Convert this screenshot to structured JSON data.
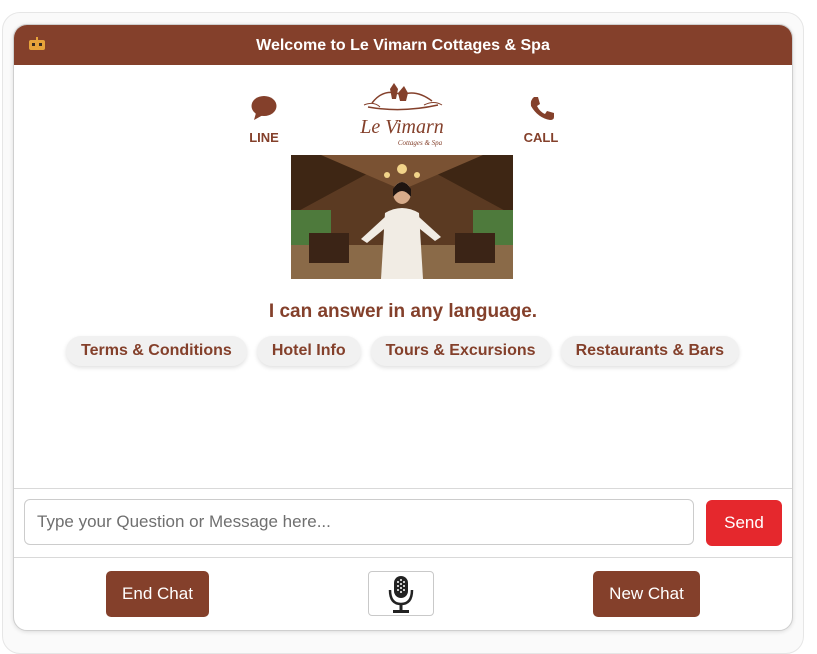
{
  "header": {
    "title": "Welcome to Le Vimarn Cottages & Spa",
    "icon": "robot-icon",
    "background": "#84402b"
  },
  "actions": {
    "line": {
      "label": "LINE",
      "icon": "chat-bubble-icon"
    },
    "call": {
      "label": "CALL",
      "icon": "phone-icon"
    }
  },
  "logo": {
    "text": "Le Vimarn",
    "subtext": "Cottages & Spa"
  },
  "tagline": "I can answer in any language.",
  "quick_replies": [
    "Terms & Conditions",
    "Hotel Info",
    "Tours & Excursions",
    "Restaurants & Bars"
  ],
  "composer": {
    "placeholder": "Type your Question or Message here...",
    "value": "",
    "send_label": "Send",
    "send_color": "#e5282d"
  },
  "footer": {
    "end_chat_label": "End Chat",
    "new_chat_label": "New Chat",
    "mic_icon": "microphone-icon"
  },
  "colors": {
    "brand": "#84402b",
    "chip_bg": "#f1f1f1"
  }
}
